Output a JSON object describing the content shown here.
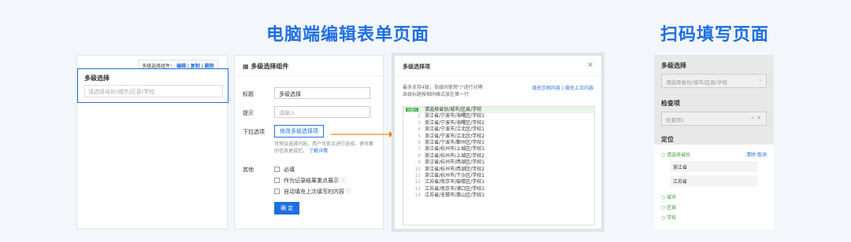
{
  "titles": {
    "desktop": "电脑端编辑表单页面",
    "mobile": "扫码填写页面"
  },
  "form": {
    "toolbar_label": "多级选择组件：",
    "toolbar_edit": "编辑",
    "toolbar_copy": "复制",
    "toolbar_delete": "删除",
    "field_label": "多级选择",
    "field_placeholder": "请选择省份/城市/区县/学校"
  },
  "settings": {
    "header": "多级选择组件",
    "title_label": "标题",
    "title_value": "多级选择",
    "hint_label": "提示",
    "hint_placeholder": "请输入",
    "options_label": "下拉选项",
    "edit_options_btn": "修改多级选择项",
    "options_hint": "可预设选择内容，用户可依次进行选择，使收集的信息更规范。",
    "learn_more": "了解详情",
    "other_label": "其他",
    "checks": [
      "必填",
      "作为记录结果重点展示",
      "自动填充上次填写的内容"
    ],
    "ok_btn": "确 定"
  },
  "dialog": {
    "title": "多级选择项",
    "close": "×",
    "desc1": "最多支持4级，各级间使用\"/\"进行分隔",
    "desc2": "各级标题按相同格式放在第一行",
    "link1": "填充示例内容",
    "link2": "填充上次内容",
    "tag": "标题行",
    "lines": [
      "请选择省份/城市/区县/学校",
      "浙江省/宁波市/海曙区/学校1",
      "浙江省/宁波市/海曙区/学校2",
      "浙江省/宁波市/江北区/学校1",
      "浙江省/宁波市/江北区/学校2",
      "浙江省/宁波市/鄞州区/学校1",
      "浙江省/杭州市/上城区/学校1",
      "浙江省/杭州市/上城区/学校2",
      "浙江省/杭州市/西湖区/学校1",
      "浙江省/杭州市/西湖区/学校2",
      "浙江省/杭州市/下沙区/学校1",
      "江苏省/南京市/鼓楼区/学校1",
      "江苏省/南京市/浦口区/学校1",
      "江苏省/无锡市/惠山区/学校1"
    ]
  },
  "mobile": {
    "sec1": "多级选择",
    "box1": "请选择省份/城市/区县/学校",
    "sec2": "检查项",
    "box2": "检查项1",
    "sec3": "定位",
    "sheet_sel": "请选择省份",
    "sheet_clear": "清除",
    "sheet_cancel": "取消",
    "opt1": "浙江省",
    "opt2": "江苏省",
    "sub1": "城市",
    "sub2": "区县",
    "sub3": "学校"
  }
}
